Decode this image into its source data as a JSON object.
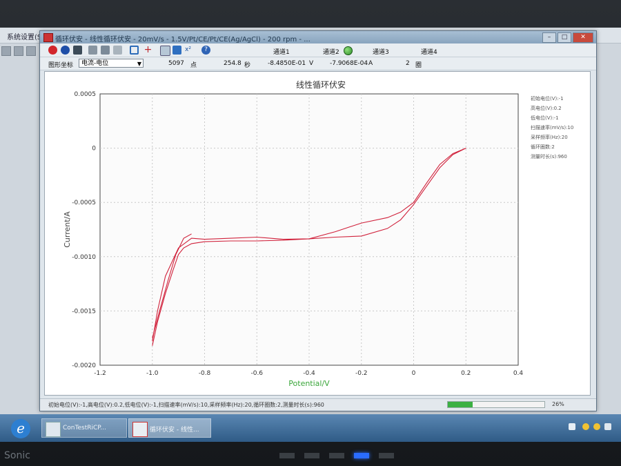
{
  "background_app": {
    "menu_label": "系统设置(S)"
  },
  "window": {
    "title": "循环伏安 - 线性循环伏安 - 20mV/s - 1.5V/Pt/CE/Pt/CE(Ag/AgCl) - 200 rpm - ...",
    "minimize": "–",
    "maximize": "□",
    "close": "✕"
  },
  "toolbar": {
    "channels": [
      "通道1",
      "通道2",
      "通道3",
      "通道4"
    ],
    "channel_led_color": "#3fae36"
  },
  "readout": {
    "axis_mode_label": "图形坐标",
    "axis_mode_value": "电流-电位",
    "points_value": "5097",
    "points_unit": "点",
    "time_value": "254.8",
    "time_unit": "秒",
    "potential_value": "-8.4850E-01",
    "potential_unit": "V",
    "current_value": "-7.9068E-04",
    "current_unit": "A",
    "cycle_value": "2",
    "cycle_unit": "圈"
  },
  "params_panel": [
    "初始电位(V):-1",
    "高电位(V):0.2",
    "低电位(V):-1",
    "扫描速率(mV/s):10",
    "采样频率(Hz):20",
    "循环圈数:2",
    "测量时长(s):960"
  ],
  "status": {
    "text": "初始电位(V):-1,高电位(V):0.2,低电位(V):-1,扫描速率(mV/s):10,采样频率(Hz):20,循环圈数:2,测量时长(s):960",
    "progress": 0.26,
    "progress_label": "26%"
  },
  "taskbar": {
    "start_glyph": "e",
    "buttons": [
      "ConTestRiCP...",
      "循环伏安 - 线性..."
    ]
  },
  "bezel": {
    "brand": "Sonic"
  },
  "chart_data": {
    "type": "line",
    "title": "线性循环伏安",
    "xlabel": "Potential/V",
    "ylabel": "Current/A",
    "xlim": [
      -1.2,
      0.4
    ],
    "ylim": [
      -0.002,
      0.0005
    ],
    "x_ticks": [
      "-1.2",
      "-1.0",
      "-0.8",
      "-0.6",
      "-0.4",
      "-0.2",
      "0",
      "0.2",
      "0.4"
    ],
    "y_ticks": [
      "0.0005",
      "0",
      "-0.0005",
      "-0.0010",
      "-0.0015",
      "-0.0020"
    ],
    "grid": true,
    "line_color": "#d0203a",
    "series": [
      {
        "x": [
          -1.0,
          -0.98,
          -0.95,
          -0.92,
          -0.9,
          -0.88,
          -0.85,
          -0.8,
          -0.7,
          -0.6,
          -0.5,
          -0.4,
          -0.3,
          -0.2,
          -0.1,
          -0.05,
          0.0,
          0.05,
          0.1,
          0.15,
          0.2
        ],
        "y": [
          -0.00182,
          -0.0016,
          -0.00134,
          -0.00112,
          -0.00098,
          -0.00092,
          -0.00088,
          -0.000862,
          -0.000855,
          -0.000855,
          -0.000848,
          -0.000835,
          -0.00082,
          -0.00081,
          -0.00074,
          -0.00066,
          -0.00052,
          -0.00035,
          -0.00018,
          -6e-05,
          0.0
        ]
      },
      {
        "x": [
          0.2,
          0.15,
          0.1,
          0.05,
          0.0,
          -0.05,
          -0.1,
          -0.2,
          -0.3,
          -0.4,
          -0.5,
          -0.6,
          -0.7,
          -0.8,
          -0.85,
          -0.9,
          -0.95,
          -0.98,
          -1.0
        ],
        "y": [
          0.0,
          -5e-05,
          -0.00015,
          -0.00032,
          -0.0005,
          -0.00059,
          -0.00064,
          -0.00069,
          -0.00077,
          -0.000835,
          -0.00084,
          -0.00082,
          -0.00083,
          -0.00084,
          -0.00083,
          -0.00092,
          -0.00118,
          -0.0015,
          -0.00178
        ]
      },
      {
        "x": [
          -1.0,
          -0.97,
          -0.94,
          -0.91,
          -0.88,
          -0.85
        ],
        "y": [
          -0.00175,
          -0.00148,
          -0.00122,
          -0.00098,
          -0.00083,
          -0.00079
        ]
      }
    ]
  }
}
